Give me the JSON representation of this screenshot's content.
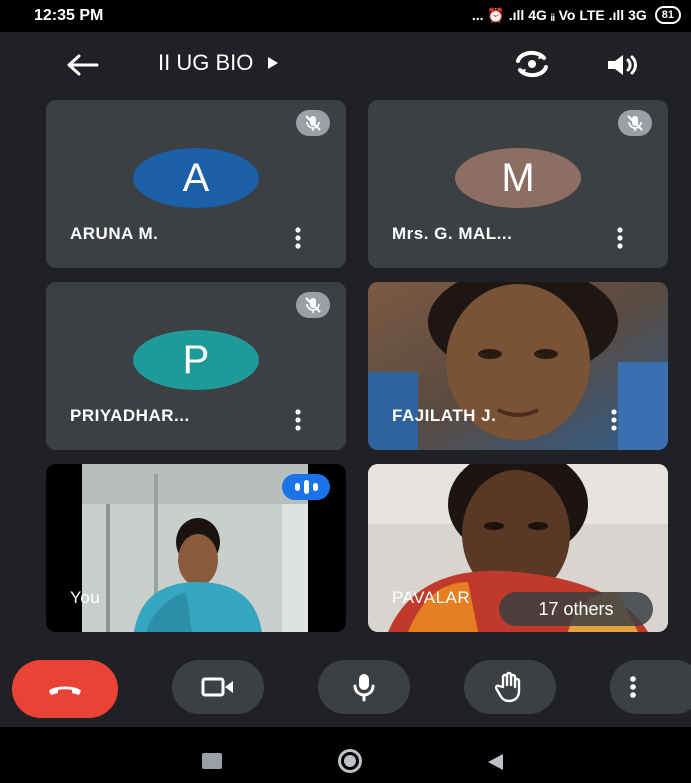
{
  "status_bar": {
    "time": "12:35 PM",
    "indicators": "... ⏰ .ıll 4G ᵢᵢ Vo LTE .ıll 3G",
    "battery": "81"
  },
  "header": {
    "meeting_title": "II UG BIO",
    "back_icon": "arrow-back-icon",
    "switch_camera_icon": "switch-camera-icon",
    "speaker_icon": "speaker-icon"
  },
  "participants": [
    {
      "name": "ARUNA M.",
      "initial": "A",
      "avatar_color": "#1a5fa8",
      "muted": true
    },
    {
      "name": "Mrs. G. MAL...",
      "initial": "M",
      "avatar_color": "#8d6e63",
      "muted": true
    },
    {
      "name": "PRIYADHAR...",
      "initial": "P",
      "avatar_color": "#1e9a9a",
      "muted": true
    },
    {
      "name": "FAJILATH J.",
      "video": true
    },
    {
      "name": "You",
      "video": true,
      "speaking": true
    },
    {
      "name": "PAVALAR",
      "video": true
    }
  ],
  "others_badge": "17 others",
  "controls": {
    "end_call_color": "#ea4335",
    "items": [
      "end-call-icon",
      "camera-icon",
      "mic-icon",
      "raise-hand-icon",
      "more-options-icon"
    ]
  },
  "nav": [
    "recents-icon",
    "home-icon",
    "back-icon"
  ]
}
